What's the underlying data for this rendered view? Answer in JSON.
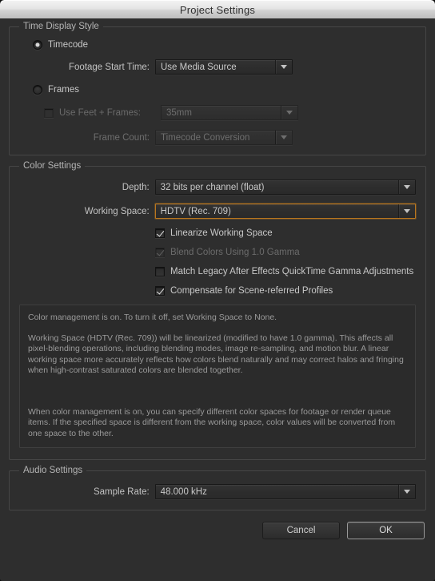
{
  "window": {
    "title": "Project Settings"
  },
  "time_display_style": {
    "group_title": "Time Display Style",
    "timecode_radio_label": "Timecode",
    "timecode_selected": true,
    "footage_start_time_label": "Footage Start Time:",
    "footage_start_time_value": "Use Media Source",
    "frames_radio_label": "Frames",
    "frames_selected": false,
    "use_feet_frames_label": "Use Feet + Frames:",
    "use_feet_frames_checked": false,
    "feet_frames_value": "35mm",
    "frame_count_label": "Frame Count:",
    "frame_count_value": "Timecode Conversion"
  },
  "color_settings": {
    "group_title": "Color Settings",
    "depth_label": "Depth:",
    "depth_value": "32 bits per channel (float)",
    "working_space_label": "Working Space:",
    "working_space_value": "HDTV (Rec. 709)",
    "working_space_focus_color": "#b8761f",
    "checkboxes": [
      {
        "label": "Linearize Working Space",
        "checked": true,
        "disabled": false
      },
      {
        "label": "Blend Colors Using 1.0 Gamma",
        "checked": true,
        "disabled": true
      },
      {
        "label": "Match Legacy After Effects QuickTime Gamma Adjustments",
        "checked": false,
        "disabled": false
      },
      {
        "label": "Compensate for Scene-referred Profiles",
        "checked": true,
        "disabled": false
      }
    ],
    "description_1": "Color management is on. To turn it off, set Working Space to None.",
    "description_2": "Working Space (HDTV (Rec. 709)) will be linearized (modified to have 1.0 gamma). This affects all pixel-blending operations, including blending modes, image re-sampling, and motion blur. A linear working space more accurately reflects how colors blend naturally and may correct halos and fringing when high-contrast saturated colors are blended together.",
    "description_3": "When color management is on, you can specify different color spaces for footage or render queue items. If the specified space is different from the working space, color values will be converted from one space to the other."
  },
  "audio_settings": {
    "group_title": "Audio Settings",
    "sample_rate_label": "Sample Rate:",
    "sample_rate_value": "48.000 kHz"
  },
  "footer": {
    "cancel_label": "Cancel",
    "ok_label": "OK"
  }
}
